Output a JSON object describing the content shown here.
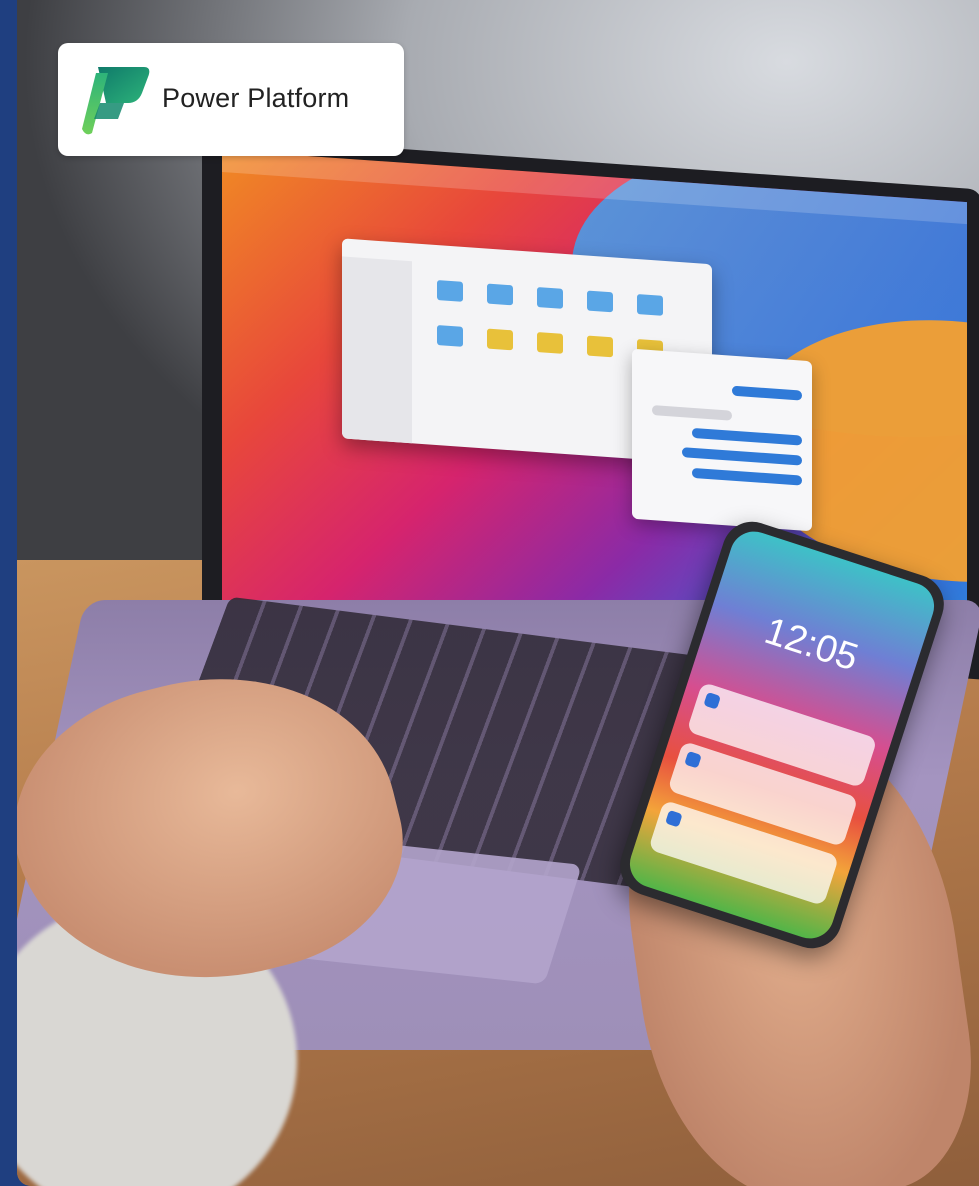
{
  "logo": {
    "brand_name": "Power Platform",
    "icon": "power-platform-logo-icon",
    "colors": [
      "#0f7a6a",
      "#2db37a",
      "#6fd05a"
    ]
  },
  "phone": {
    "clock": "12:05"
  },
  "colors": {
    "frame": "#1f3f80",
    "logo_card": "#ffffff"
  }
}
